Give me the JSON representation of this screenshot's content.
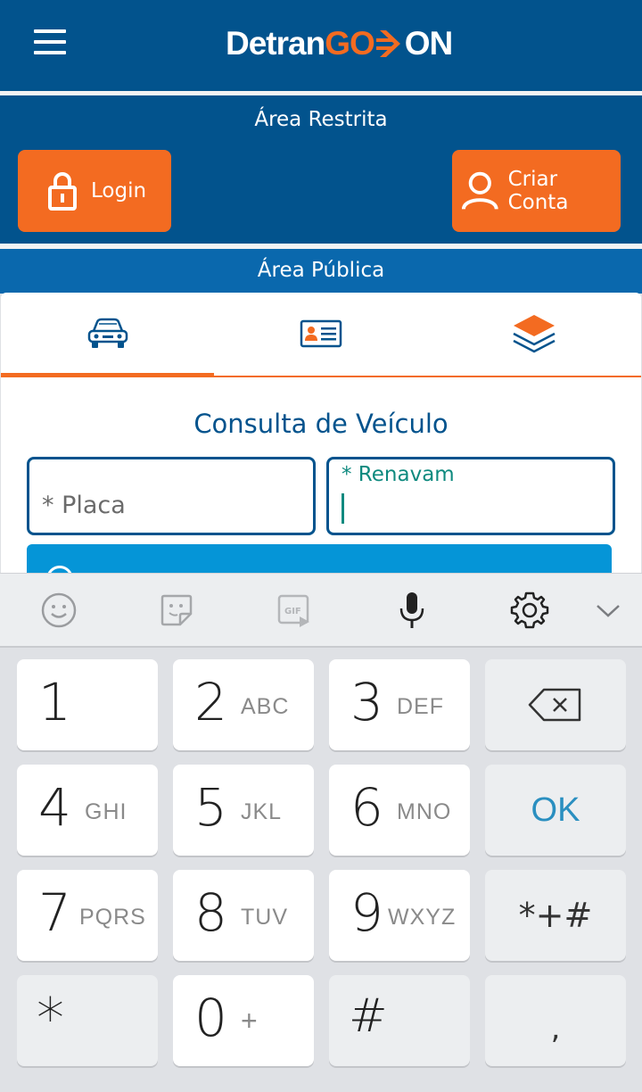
{
  "header": {
    "logo": {
      "part1": "Detran",
      "part2": "GO",
      "part3": "ON"
    },
    "colors": {
      "primary": "#02538d",
      "accent": "#f36b21"
    }
  },
  "restrita": {
    "title": "Área Restrita",
    "login_label": "Login",
    "criar_label": "Criar Conta"
  },
  "publica": {
    "title": "Área Pública",
    "tabs": [
      {
        "name": "veiculo",
        "icon": "car-icon",
        "active": true
      },
      {
        "name": "habilitacao",
        "icon": "id-card-icon",
        "active": false
      },
      {
        "name": "outros",
        "icon": "layers-icon",
        "active": false
      }
    ]
  },
  "consulta": {
    "title": "Consulta de Veículo",
    "placa_placeholder": "* Placa",
    "renavam_label": "* Renavam",
    "renavam_value": ""
  },
  "keyboard": {
    "toolbar": [
      "emoji-icon",
      "sticker-icon",
      "gif-icon",
      "microphone-icon",
      "settings-icon",
      "chevron-down-icon"
    ],
    "gif_text": "GIF",
    "keys": [
      {
        "n": "1",
        "l": ""
      },
      {
        "n": "2",
        "l": "ABC"
      },
      {
        "n": "3",
        "l": "DEF"
      },
      {
        "n": "4",
        "l": "GHI"
      },
      {
        "n": "5",
        "l": "JKL"
      },
      {
        "n": "6",
        "l": "MNO"
      },
      {
        "n": "7",
        "l": "PQRS"
      },
      {
        "n": "8",
        "l": "TUV"
      },
      {
        "n": "9",
        "l": "WXYZ"
      },
      {
        "n": "0",
        "l": "+"
      }
    ],
    "ok": "OK",
    "symbols": "*+#",
    "star": "*",
    "hash": "#",
    "comma": ","
  }
}
